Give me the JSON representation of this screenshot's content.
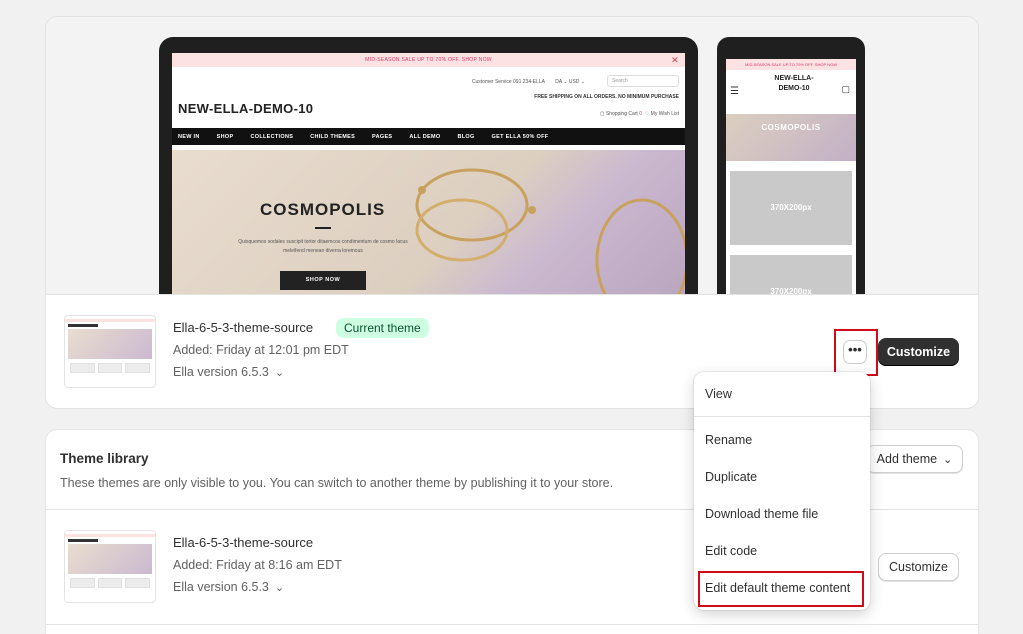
{
  "current_theme": {
    "preview": {
      "desktop": {
        "banner": "MID-SEASON SALE UP TO 70% OFF. SHOP NOW",
        "customer_service": "Customer Service 091 234-ELLA",
        "language": "DA ⌄",
        "currency": "USD ⌄",
        "search_placeholder": "Search",
        "logo": "NEW-ELLA-DEMO-10",
        "shipping_note": "FREE SHIPPING ON ALL ORDERS. NO MINIMUM PURCHASE",
        "cart_label": "Shopping Cart",
        "cart_count": "0",
        "wishlist_label": "My Wish List",
        "nav": [
          "NEW IN",
          "SHOP",
          "COLLECTIONS",
          "CHILD THEMES",
          "PAGES",
          "ALL DEMO",
          "BLOG",
          "GET ELLA 50% OFF"
        ],
        "hero_title": "COSMOPOLIS",
        "hero_text": "Quisquemos sodales suscipit tortor ditaemcos condimentum de cosmo lacus meleifend menean diverra loremous",
        "hero_button": "SHOP NOW"
      },
      "mobile": {
        "banner": "MID-SEASON SALE UP TO 70% OFF. SHOP NOW",
        "logo": "NEW-ELLA-DEMO-10",
        "hero_title": "COSMOPOLIS",
        "tile_1": "370X200px",
        "tile_2": "370X200px"
      }
    },
    "name": "Ella-6-5-3-theme-source",
    "badge": "Current theme",
    "added": "Added: Friday at 12:01 pm EDT",
    "version": "Ella version 6.5.3",
    "more_label": "•••",
    "customize_label": "Customize"
  },
  "dropdown": {
    "items": [
      "View",
      "Rename",
      "Duplicate",
      "Download theme file",
      "Edit code",
      "Edit default theme content"
    ]
  },
  "library": {
    "title": "Theme library",
    "subtitle": "These themes are only visible to you. You can switch to another theme by publishing it to your store.",
    "add_theme_label": "Add theme",
    "themes": [
      {
        "name": "Ella-6-5-3-theme-source",
        "added": "Added: Friday at 8:16 am EDT",
        "version": "Ella version 6.5.3",
        "customize_label": "Customize"
      }
    ]
  },
  "colors": {
    "highlight": "#d10a1a",
    "primary_button": "#303030",
    "badge_bg": "#cdfee1"
  }
}
